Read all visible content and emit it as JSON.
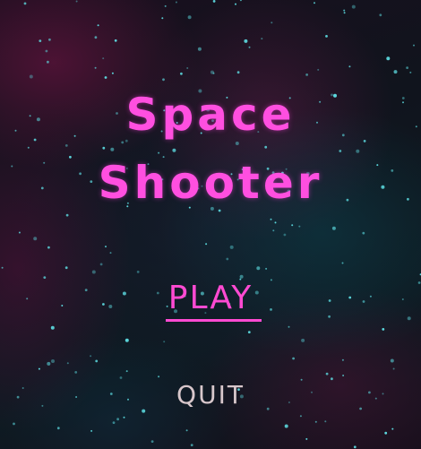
{
  "game": {
    "title_line1": "Space",
    "title_line2": "Shooter",
    "menu": {
      "play_label": "PLAY",
      "quit_label": "QUIT"
    }
  },
  "colors": {
    "title": "#ff4fe0",
    "play": "#ff4ad2",
    "quit": "#d8c7cb",
    "star": "#5fe3e8"
  }
}
